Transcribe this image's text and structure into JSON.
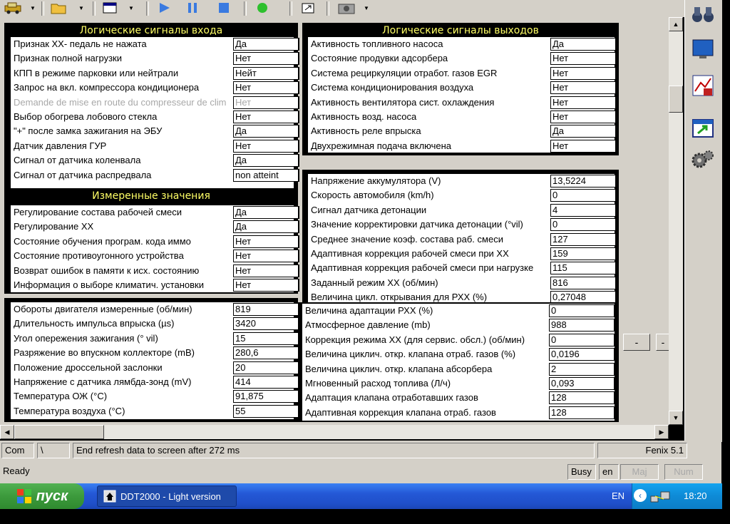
{
  "toolbar": {
    "icons": [
      "car-icon",
      "dropdown-arrow",
      "folder-icon",
      "dropdown-arrow",
      "window-icon",
      "dropdown-arrow",
      "play-icon",
      "pause-icon",
      "stop-icon",
      "green-light-icon",
      "export-icon",
      "camera-icon",
      "dropdown-arrow"
    ]
  },
  "panels": {
    "inputs": {
      "title": "Логические сигналы входа",
      "rows": [
        {
          "label": "Признак ХХ- педаль не нажата",
          "value": "Да",
          "disabled": false
        },
        {
          "label": "Признак полной нагрузки",
          "value": "Нет",
          "disabled": false
        },
        {
          "label": "КПП в режиме парковки или нейтрали",
          "value": "Нейт",
          "disabled": false
        },
        {
          "label": "Запрос на вкл. компрессора кондиционера",
          "value": "Нет",
          "disabled": false
        },
        {
          "label": "Demande de mise en route du compresseur de clim",
          "value": "Нет",
          "disabled": true
        },
        {
          "label": "Выбор обогрева лобового стекла",
          "value": "Нет",
          "disabled": false
        },
        {
          "label": "\"+\" после замка зажигания на ЭБУ",
          "value": "Да",
          "disabled": false
        },
        {
          "label": "Датчик давления ГУР",
          "value": "Нет",
          "disabled": false
        },
        {
          "label": "Сигнал от датчика коленвала",
          "value": "Да",
          "disabled": false
        },
        {
          "label": "Сигнал от датчика распредвала",
          "value": "non atteint",
          "disabled": false
        }
      ]
    },
    "outputs": {
      "title": "Логические сигналы выходов",
      "rows": [
        {
          "label": "Активность топливного насоса",
          "value": "Да"
        },
        {
          "label": "Состояние продувки адсорбера",
          "value": "Нет"
        },
        {
          "label": "Система рециркуляции отработ. газов EGR",
          "value": "Нет"
        },
        {
          "label": "Система кондиционирования воздуха",
          "value": "Нет"
        },
        {
          "label": "Активность вентилятора сист. охлаждения",
          "value": "Нет"
        },
        {
          "label": "Активность возд. насоса",
          "value": "Нет"
        },
        {
          "label": "Активность реле впрыска",
          "value": "Да"
        },
        {
          "label": "Двухрежимная подача включена",
          "value": "Нет"
        }
      ]
    },
    "measured": {
      "title": "Измеренные значения",
      "rows": [
        {
          "label": "Регулирование состава рабочей смеси",
          "value": "Да"
        },
        {
          "label": "Регулирование ХХ",
          "value": "Да"
        },
        {
          "label": "Состояние обучения програм. кода иммо",
          "value": "Нет"
        },
        {
          "label": "Состояние противоугонного устройства",
          "value": "Нет"
        },
        {
          "label": "Возврат ошибок в памяти к исх. состоянию",
          "value": "Нет"
        },
        {
          "label": "Информация о выборе климатич. установки",
          "value": "Нет"
        }
      ]
    },
    "engine": {
      "rows": [
        {
          "label": "Обороты двигателя измеренные (об/мин)",
          "value": "819"
        },
        {
          "label": "Длительность импульса впрыска (µs)",
          "value": "3420"
        },
        {
          "label": "Угол опережения зажигания (° vil)",
          "value": "15"
        },
        {
          "label": "Разряжение во впускном коллекторе (mB)",
          "value": "280,6"
        },
        {
          "label": "Положение дроссельной заслонки",
          "value": "20"
        },
        {
          "label": "Напряжение с датчика лямбда-зонд (mV)",
          "value": "414"
        },
        {
          "label": "Температура ОЖ (°C)",
          "value": "91,875"
        },
        {
          "label": "Температура воздуха (°C)",
          "value": "55"
        }
      ]
    },
    "params": {
      "rows": [
        {
          "label": "Напряжение аккумулятора (V)",
          "value": "13,5224"
        },
        {
          "label": "Скорость автомобиля (km/h)",
          "value": "0"
        },
        {
          "label": "Сигнал датчика детонации",
          "value": "4"
        },
        {
          "label": "Значение корректировки датчика детонации (°vil)",
          "value": "0"
        },
        {
          "label": "Среднее значение коэф. состава раб. смеси",
          "value": "127"
        },
        {
          "label": "Адаптивная коррекция рабочей смеси при ХХ",
          "value": "159"
        },
        {
          "label": "Адаптивная коррекция рабочей смеси при нагрузке",
          "value": "115"
        },
        {
          "label": "Заданный режим ХХ (об/мин)",
          "value": "816"
        },
        {
          "label": "Величина цикл. открывания для РХХ (%)",
          "value": "0,27048"
        }
      ]
    },
    "params2": {
      "rows": [
        {
          "label": "Величина адаптации РХХ (%)",
          "value": "0"
        },
        {
          "label": "Атмосферное давление (mb)",
          "value": "988"
        },
        {
          "label": "Коррекция режима ХХ (для сервис. обсл.) (об/мин)",
          "value": "0"
        },
        {
          "label": "Величина циклич. откр. клапана отраб. газов (%)",
          "value": "0,0196"
        },
        {
          "label": "Величина циклич. откр. клапана абсорбера",
          "value": "2"
        },
        {
          "label": "Мгновенный расход топлива (Л/ч)",
          "value": "0,093"
        },
        {
          "label": "Адаптация клапана отработавших газов",
          "value": "128"
        },
        {
          "label": "Адаптивная коррекция клапана отраб. газов",
          "value": "128"
        }
      ]
    }
  },
  "side_buttons": {
    "minus1": "-",
    "minus2": "-"
  },
  "status1": {
    "com": "Com",
    "sep": "\\",
    "message": "End refresh data to screen after 272 ms",
    "version": "Fenix 5.1"
  },
  "status2": {
    "ready": "Ready",
    "busy": "Busy",
    "lang": "en",
    "maj": "Maj",
    "num": "Num"
  },
  "taskbar": {
    "start": "пуск",
    "task": "DDT2000 - Light version",
    "lang": "EN",
    "clock": "18:20"
  }
}
